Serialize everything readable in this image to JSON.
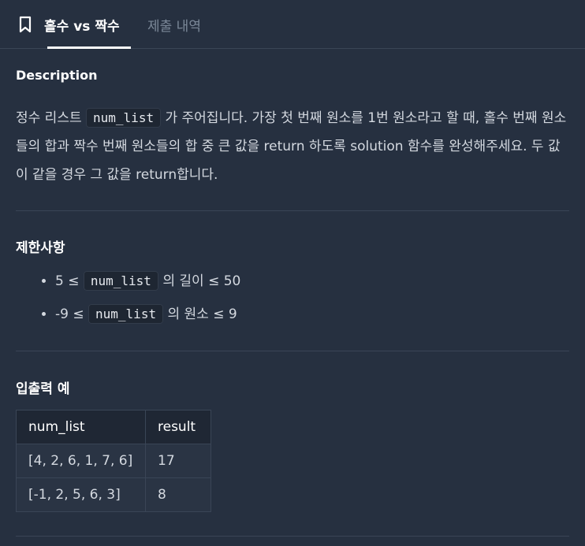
{
  "tabs": {
    "active_label": "홀수 vs 짝수",
    "inactive_label": "제출 내역"
  },
  "description": {
    "heading": "Description",
    "p1": "정수 리스트 ",
    "code1": "num_list",
    "p2": " 가 주어집니다. 가장 첫 번째 원소를 1번 원소라고 할 때, 홀수 번째 원소들의 합과 짝수 번째 원소들의 합 중 큰 값을 return 하도록 solution 함수를 완성해주세요. 두 값이 같을 경우 그 값을 return합니다."
  },
  "constraints": {
    "heading": "제한사항",
    "items": [
      {
        "prefix": "5 ≤ ",
        "code": "num_list",
        "suffix": " 의 길이 ≤ 50"
      },
      {
        "prefix": "-9 ≤ ",
        "code": "num_list",
        "suffix": " 의 원소 ≤ 9"
      }
    ]
  },
  "examples": {
    "heading": "입출력 예",
    "columns": [
      "num_list",
      "result"
    ],
    "rows": [
      [
        "[4, 2, 6, 1, 7, 6]",
        "17"
      ],
      [
        "[-1, 2, 5, 6, 3]",
        "8"
      ]
    ]
  }
}
